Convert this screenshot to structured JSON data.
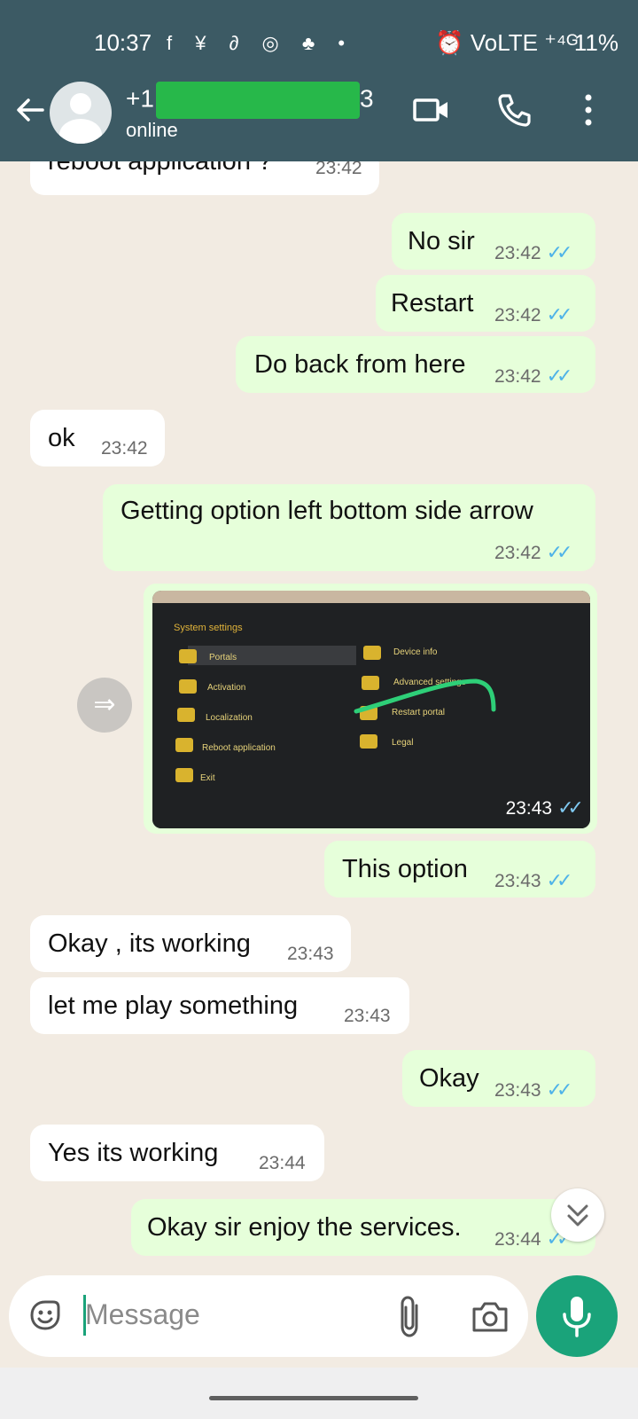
{
  "status_bar": {
    "time": "10:37",
    "icons": "f ¥ ∂ ◎ ♣ •",
    "right": "⏰ VoLTE ⁺⁴ᴳ",
    "battery": "11%"
  },
  "header": {
    "contact_prefix": "+1",
    "contact_suffix": "3",
    "status": "online"
  },
  "messages": [
    {
      "dir": "in",
      "text": "reboot application ?",
      "time": "23:42"
    },
    {
      "dir": "out",
      "text": "No sir",
      "time": "23:42"
    },
    {
      "dir": "out",
      "text": "Restart",
      "time": "23:42"
    },
    {
      "dir": "out",
      "text": "Do back from here",
      "time": "23:42"
    },
    {
      "dir": "in",
      "text": "ok",
      "time": "23:42"
    },
    {
      "dir": "out",
      "text": "Getting option left bottom side arrow",
      "time": "23:42"
    },
    {
      "dir": "out",
      "text": "This option",
      "time": "23:43"
    },
    {
      "dir": "in",
      "text": "Okay , its working",
      "time": "23:43"
    },
    {
      "dir": "in",
      "text": "let me play something",
      "time": "23:43"
    },
    {
      "dir": "out",
      "text": "Okay",
      "time": "23:43"
    },
    {
      "dir": "in",
      "text": "Yes its working",
      "time": "23:44"
    },
    {
      "dir": "out",
      "text": "Okay sir enjoy the services.",
      "time": "23:44"
    }
  ],
  "photo": {
    "time": "23:43",
    "title": "System settings",
    "left_items": [
      "Portals",
      "Activation",
      "Localization",
      "Reboot application",
      "Exit"
    ],
    "right_items": [
      "Device info",
      "Advanced settings",
      "Restart portal",
      "Legal"
    ]
  },
  "ticks": "✓✓",
  "input": {
    "placeholder": "Message"
  },
  "colors": {
    "header": "#3c5a64",
    "outgoing": "#e6ffda",
    "incoming": "#ffffff",
    "accent": "#1aa37a",
    "read_ticks": "#4fb3e8"
  }
}
